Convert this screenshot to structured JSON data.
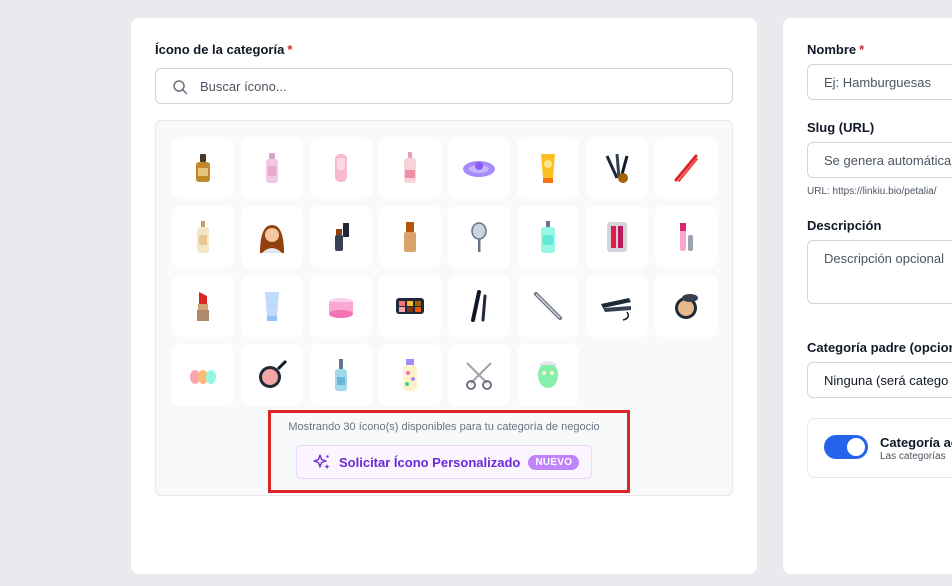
{
  "left_card": {
    "icon_label": "Ícono de la categoría",
    "required_mark": "*",
    "search_placeholder": "Buscar ícono...",
    "icons": [
      "serum-bottle-icon",
      "pink-lotion-bottle-icon",
      "pink-tube-icon",
      "pink-spray-bottle-icon",
      "purple-headband-icon",
      "sunscreen-tube-icon",
      "makeup-brushes-icon",
      "red-tweezers-icon",
      "pump-bottle-icon",
      "woman-portrait-icon",
      "eyeliner-icon",
      "foundation-bottle-icon",
      "hand-mirror-icon",
      "soap-dispenser-icon",
      "lipstick-palette-icon",
      "lip-gloss-icon",
      "red-lipstick-icon",
      "blue-tube-icon",
      "cream-jar-icon",
      "eyeshadow-palette-icon",
      "mascara-icon",
      "nail-file-icon",
      "hair-straightener-icon",
      "compact-powder-icon",
      "beauty-sponges-icon",
      "blush-compact-icon",
      "dropper-bottle-icon",
      "floral-bottle-icon",
      "scissors-icon",
      "face-mask-icon"
    ],
    "count_text": "Mostrando 30 ícono(s) disponibles para tu categoría de negocio",
    "request_button": "Solicitar Ícono Personalizado",
    "badge": "NUEVO"
  },
  "right_card": {
    "name_label": "Nombre",
    "name_required": "*",
    "name_placeholder": "Ej: Hamburguesas",
    "slug_label": "Slug (URL)",
    "slug_placeholder": "Se genera automática",
    "slug_hint": "URL: https://linkiu.bio/petalia/",
    "description_label": "Descripción",
    "description_placeholder": "Descripción opcional",
    "parent_label": "Categoría padre (opcion",
    "parent_value": "Ninguna (será catego",
    "toggle_title": "Categoría ac",
    "toggle_sub": "Las categorías",
    "toggle_on": true
  },
  "colors": {
    "accent_purple": "#6d28d9",
    "badge_purple": "#c084fc",
    "toggle_blue": "#2563eb",
    "required_red": "#dc2626",
    "highlight_red": "#dc2626"
  }
}
